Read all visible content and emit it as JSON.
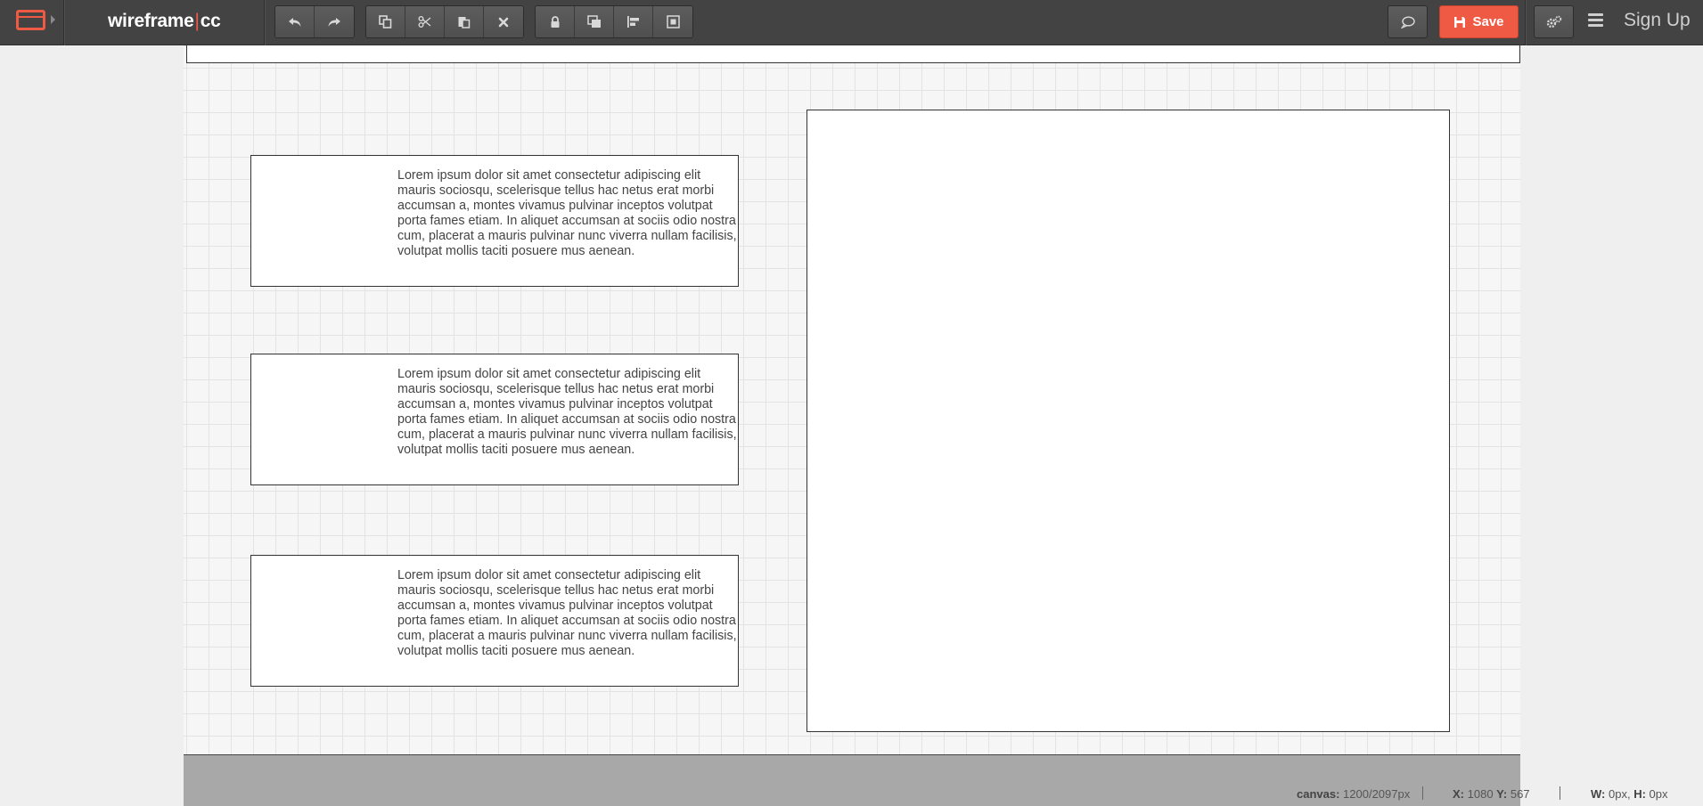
{
  "app": {
    "logo_left": "wireframe",
    "logo_sep": "|",
    "logo_right": "cc"
  },
  "toolbar": {
    "history": [
      {
        "name": "undo-icon"
      },
      {
        "name": "redo-icon"
      }
    ],
    "edit": [
      {
        "name": "copy-icon"
      },
      {
        "name": "cut-icon"
      },
      {
        "name": "paste-icon"
      },
      {
        "name": "delete-icon"
      }
    ],
    "arrange": [
      {
        "name": "lock-icon"
      },
      {
        "name": "bring-to-front-icon"
      },
      {
        "name": "align-left-icon"
      },
      {
        "name": "send-to-back-icon"
      }
    ],
    "save_label": "Save",
    "signup_label": "Sign Up"
  },
  "canvas": {
    "text_blocks": [
      {
        "text": "Lorem ipsum dolor sit amet consectetur adipiscing elit mauris sociosqu, scelerisque tellus hac netus erat morbi accumsan a, montes vivamus pulvinar inceptos volutpat porta fames etiam. In aliquet accumsan at sociis odio nostra cum, placerat a mauris pulvinar nunc viverra nullam facilisis, volutpat mollis taciti posuere mus aenean."
      },
      {
        "text": "Lorem ipsum dolor sit amet consectetur adipiscing elit mauris sociosqu, scelerisque tellus hac netus erat morbi accumsan a, montes vivamus pulvinar inceptos volutpat porta fames etiam. In aliquet accumsan at sociis odio nostra cum, placerat a mauris pulvinar nunc viverra nullam facilisis, volutpat mollis taciti posuere mus aenean."
      },
      {
        "text": "Lorem ipsum dolor sit amet consectetur adipiscing elit mauris sociosqu, scelerisque tellus hac netus erat morbi accumsan a, montes vivamus pulvinar inceptos volutpat porta fames etiam. In aliquet accumsan at sociis odio nostra cum, placerat a mauris pulvinar nunc viverra nullam facilisis, volutpat mollis taciti posuere mus aenean."
      }
    ]
  },
  "status": {
    "canvas_label": "canvas:",
    "canvas_value": "1200/2097px",
    "x_label": "X:",
    "x_value": "1080",
    "y_label": "Y:",
    "y_value": "567",
    "w_label": "W:",
    "w_value": "0px,",
    "h_label": "H:",
    "h_value": "0px"
  },
  "colors": {
    "accent": "#ef5a45",
    "toolbar_bg": "#434343",
    "canvas_bg": "#f6f6f6"
  }
}
